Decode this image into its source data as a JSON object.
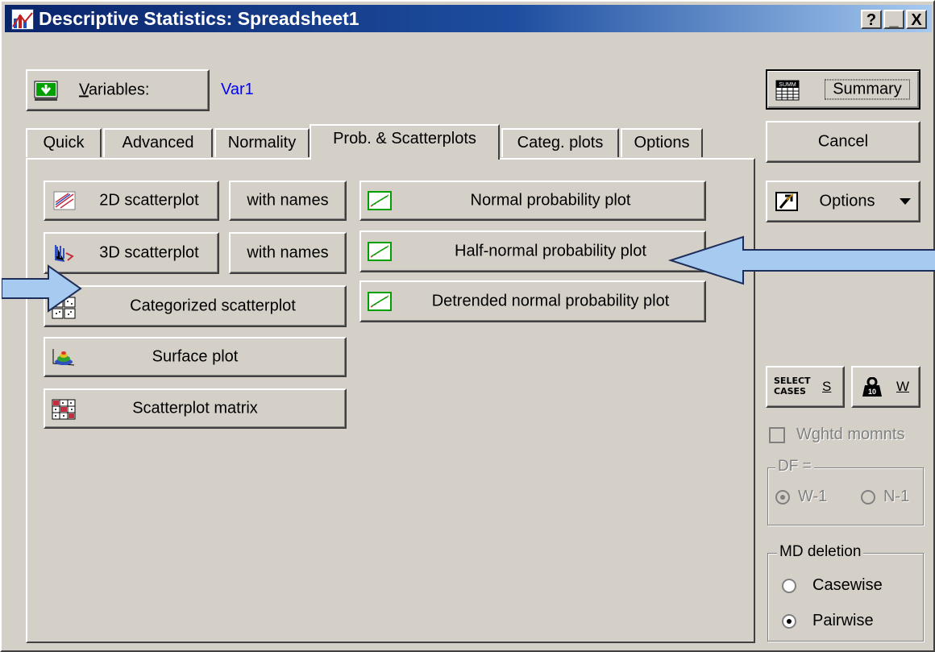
{
  "window": {
    "title": "Descriptive Statistics: Spreadsheet1",
    "help_btn": "?",
    "min_btn": "_",
    "close_btn": "X"
  },
  "variables": {
    "button_label": "Variables:",
    "value": "Var1",
    "value_color": "#0000ff"
  },
  "tabs": [
    {
      "label": "Quick"
    },
    {
      "label": "Advanced"
    },
    {
      "label": "Normality"
    },
    {
      "label": "Prob. & Scatterplots",
      "active": true
    },
    {
      "label": "Categ. plots"
    },
    {
      "label": "Options"
    }
  ],
  "panel": {
    "scatter_2d": "2D scatterplot",
    "scatter_2d_names": "with names",
    "scatter_3d": "3D scatterplot",
    "scatter_3d_names": "with names",
    "categorized": "Categorized scatterplot",
    "surface": "Surface plot",
    "matrix": "Scatterplot matrix",
    "normal_prob": "Normal probability plot",
    "halfnormal_prob": "Half-normal probability plot",
    "detrended_prob": "Detrended normal probability plot"
  },
  "side": {
    "summary": "Summary",
    "cancel": "Cancel",
    "options": "Options",
    "select_cases_line1": "SELECT",
    "select_cases_line2": "CASES",
    "select_cases_key": "S",
    "weight_key": "W",
    "weighted_moments": "Wghtd momnts",
    "df_label": "DF =",
    "df_w1": "W-1",
    "df_n1": "N-1",
    "md_label": "MD deletion",
    "md_casewise": "Casewise",
    "md_pairwise": "Pairwise",
    "md_selected": "Pairwise"
  },
  "annotations": {
    "arrow_color": "#a6caf0",
    "arrow_stroke": "#1e2e5a"
  }
}
